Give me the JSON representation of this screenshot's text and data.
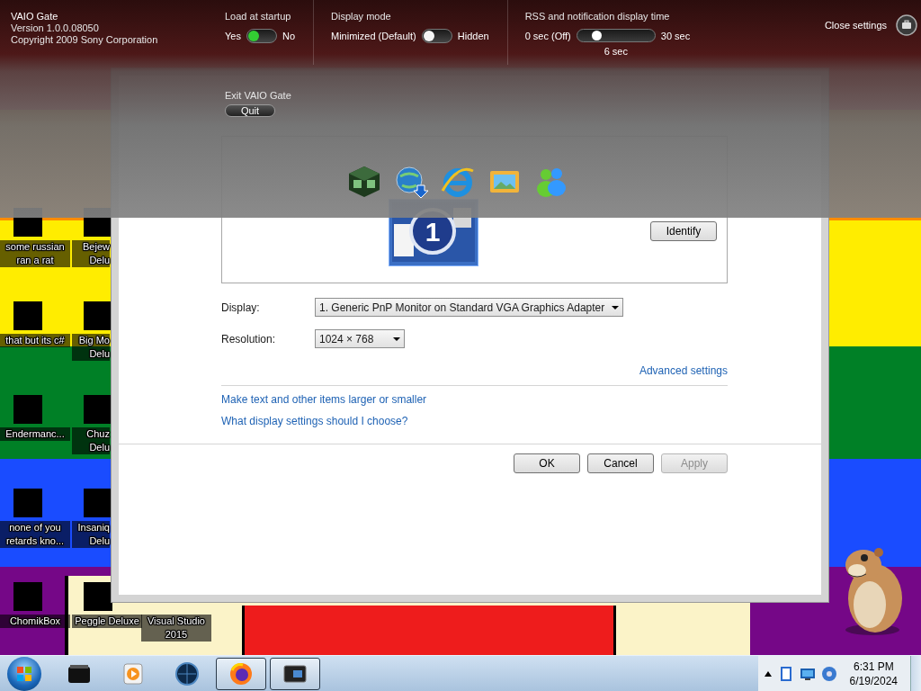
{
  "vaio_gate": {
    "title": "VAIO Gate",
    "version": "Version 1.0.0.08050",
    "copyright": "Copyright 2009 Sony Corporation",
    "toggles": [
      {
        "label": "Load at startup",
        "color": "#33cc33",
        "options": [
          {
            "label": "Yes",
            "selected": true
          },
          {
            "label": "No",
            "selected": false
          }
        ]
      },
      {
        "label": "Display mode",
        "color": "#f4f4f4",
        "options": [
          {
            "label": "Minimized (Default)",
            "selected": true
          },
          {
            "label": "Hidden",
            "selected": false
          }
        ]
      }
    ],
    "display_time": {
      "label": "RSS and notification display time",
      "min": "0 sec (Off)",
      "max": "30 sec",
      "level": 0.2,
      "reading": "6 sec"
    },
    "close_settings": "Close settings",
    "exit": {
      "label": "Exit VAIO Gate",
      "button": "Quit"
    }
  },
  "dialog": {
    "preview_number": "1",
    "identify_button": "Identify",
    "fields": [
      {
        "label": "Display:",
        "value": "1. Generic PnP Monitor on Standard VGA Graphics Adapter"
      },
      {
        "label": "Resolution:",
        "value": "1024 × 768"
      }
    ],
    "advanced_link": "Advanced settings",
    "links": [
      "Make text and other items larger or smaller",
      "What display settings should I choose?"
    ],
    "buttons": [
      {
        "label": "OK",
        "disabled": false
      },
      {
        "label": "Cancel",
        "disabled": false
      },
      {
        "label": "Apply",
        "disabled": true
      }
    ]
  },
  "desktop_icons": [
    {
      "label": "some russian ran a rat"
    },
    {
      "label": "that but its c#"
    },
    {
      "label": "Endermanc..."
    },
    {
      "label": "none of you retards kno..."
    },
    {
      "label": "ChomikBox"
    },
    {
      "label": "Bejew Delu"
    },
    {
      "label": "Big Mo Delu"
    },
    {
      "label": "Chuz Delu"
    },
    {
      "label": "Insaniq Delu"
    },
    {
      "label": "Peggle Deluxe"
    },
    {
      "label": "Visual Studio 2015"
    }
  ],
  "taskbar": {
    "apps": [
      {
        "active": false
      },
      {
        "active": false
      },
      {
        "active": false
      },
      {
        "active": true
      },
      {
        "active": true
      }
    ],
    "time": "6:31 PM",
    "date": "6/19/2024"
  }
}
